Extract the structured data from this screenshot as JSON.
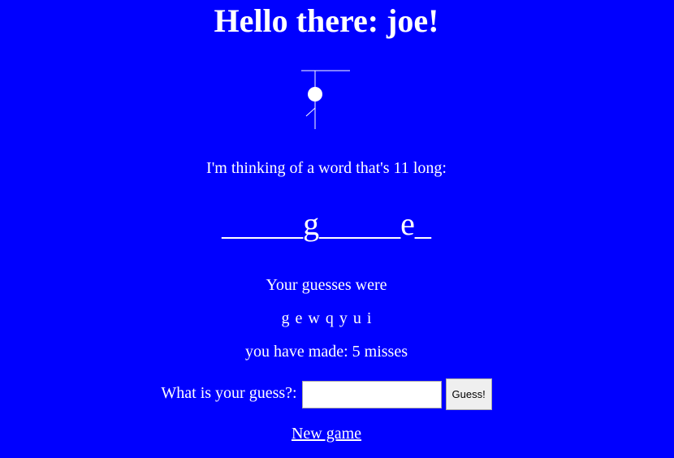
{
  "greeting": "Hello there: joe!",
  "intro": "I'm thinking of a word that's 11 long:",
  "word_display": "_____g_____e_",
  "guesses_heading": "Your guesses were",
  "guesses_list": "g e w q y u i",
  "misses_text": "you have made: 5 misses",
  "form": {
    "label": "What is your guess?:",
    "input_value": "",
    "button_label": "Guess!"
  },
  "new_game_link": "New game",
  "colors": {
    "background": "#0000ff",
    "text": "#ffffff"
  }
}
